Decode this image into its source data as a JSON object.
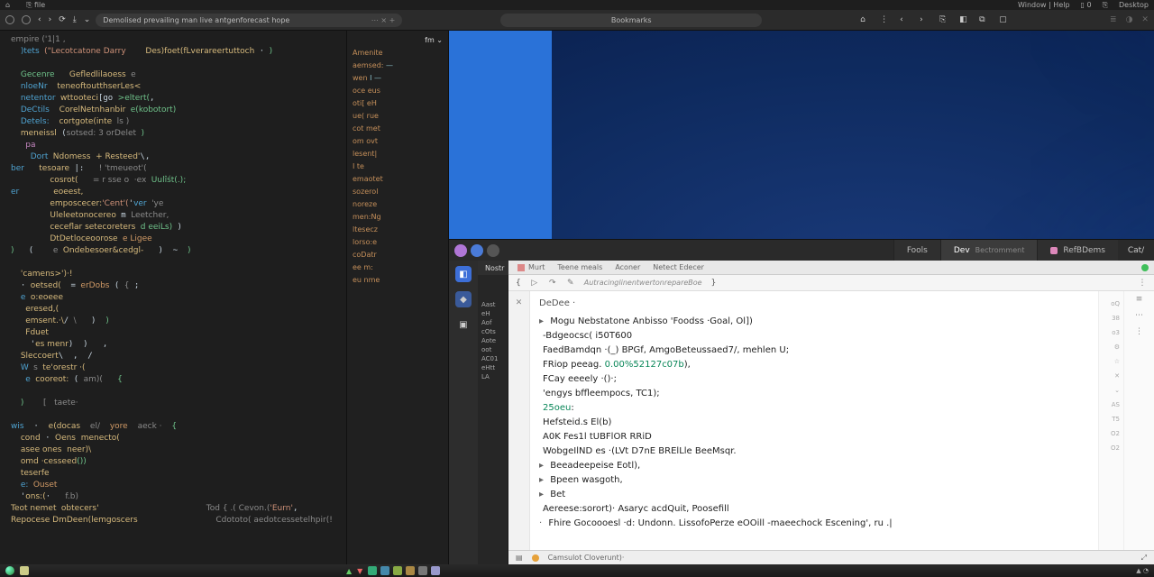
{
  "os_title": {
    "left_items": [
      "⌂",
      "⎘ file"
    ],
    "right_items": [
      "Window | Help",
      "▯ 0",
      "⎘",
      "Desktop"
    ]
  },
  "browser": {
    "url_text": "Demolised prevailing man live antgenforecast hope",
    "url_suffix": "⋯  ×   +",
    "center_text": "Bookmarks",
    "right_glyphs": [
      "⌂",
      "⋮",
      "‹",
      "›",
      "⎘",
      "◧",
      "⧉",
      "▢"
    ],
    "far_glyphs": [
      "≣",
      "◑",
      "✕"
    ]
  },
  "editor_header": "empire ('1|1 ,",
  "outline": {
    "top": "fm ⌄",
    "items": [
      {
        "k": "Amenite",
        "v": ""
      },
      {
        "k": "aemsed:",
        "v": "—"
      },
      {
        "k": "wen",
        "v": "I  —"
      },
      {
        "k": "",
        "v": ""
      },
      {
        "k": "oce eus",
        "v": ""
      },
      {
        "k": "oti[ eH",
        "v": ""
      },
      {
        "k": "ue( rue",
        "v": ""
      },
      {
        "k": "cot met",
        "v": ""
      },
      {
        "k": "om ovt",
        "v": ""
      },
      {
        "k": "lesent|",
        "v": ""
      },
      {
        "k": "    I te",
        "v": ""
      },
      {
        "k": "",
        "v": ""
      },
      {
        "k": "",
        "v": ""
      },
      {
        "k": "emaotet",
        "v": ""
      },
      {
        "k": "sozerol",
        "v": ""
      },
      {
        "k": "noreze",
        "v": ""
      },
      {
        "k": "men:Ng",
        "v": ""
      },
      {
        "k": "ltesecz",
        "v": ""
      },
      {
        "k": "lorso:e",
        "v": ""
      },
      {
        "k": "coDatr",
        "v": ""
      },
      {
        "k": "ee m:",
        "v": ""
      },
      {
        "k": "eu nme",
        "v": ""
      }
    ]
  },
  "devtools": {
    "tabs": [
      {
        "label": "Fools",
        "active": false
      },
      {
        "label": "Dev",
        "sub": "Bectromment",
        "active": true
      },
      {
        "label": "RefBDems",
        "active": false,
        "icon": "#d8b"
      }
    ],
    "gear": "Cat/",
    "activity": [
      "◧",
      "◆",
      "▣"
    ],
    "sidelist_header": "Nostr",
    "sidelist": [
      "Aast",
      "eH",
      "Aof",
      "cOts",
      "Aote",
      "oot",
      "AC01",
      "eHtt",
      "LA"
    ],
    "subtabs": [
      "Murt",
      "Teene meals",
      "Aconer",
      "Netect Edecer"
    ],
    "toolbar_path": "AutracinglinentwertonrepareBoe",
    "toolbar_brace_l": "{",
    "toolbar_brace_r": "}",
    "gutter": [
      "✕",
      "",
      "",
      "",
      "",
      "",
      "",
      "",
      "",
      "",
      "",
      "",
      ""
    ],
    "debug_label": "DeDee ·",
    "lines": [
      {
        "pre": "▸ ",
        "t": "Mogu Nebstatone Anbisso 'Foodss ·Goal, Ol])"
      },
      {
        "pre": "  ",
        "t": "-Bdgeocsc(  i50T600"
      },
      {
        "pre": "  ",
        "t": "FaedBamdqn ·(_) BPGf, AmgoBeteussaed7/, mehlen U;"
      },
      {
        "pre": "  ",
        "t": "FRiop peeag. 0.00%52127c07b),"
      },
      {
        "pre": "  ",
        "t": "FCay eeeely ·()·;"
      },
      {
        "pre": "  ",
        "t": "'engys bffleempocs, TC1);"
      },
      {
        "pre": "  ",
        "t": "25oeu:"
      },
      {
        "pre": "    ",
        "t": "Hefsteid.s El(b)"
      },
      {
        "pre": "    ",
        "t": "A0K Fes1l tUBFlOR RRiD"
      },
      {
        "pre": "    ",
        "t": "WobgeIlND es ·(LVt D7nE BRElLle BeeMsqr."
      },
      {
        "pre": "▸ ",
        "t": "Beeadeepeise Eotl),"
      },
      {
        "pre": "▸ ",
        "t": "Bpeen wasgoth,"
      },
      {
        "pre": "▸ ",
        "t": "Bet"
      },
      {
        "pre": "    ",
        "t": "Aereese:sorort)· Asaryc acdQuit, Poosefill"
      },
      {
        "pre": "  · ",
        "t": "Fhire Gocoooesl ·d: Undonn. LissofoPerze eOOill -maeechock Escening', ru .|"
      }
    ],
    "ruler": [
      "oQ",
      "38",
      "o3",
      "",
      "⚙",
      "",
      "☆",
      "",
      "✕",
      "⌄",
      "",
      "AS",
      "T5",
      "O2",
      "O2"
    ],
    "iconcol": [
      "≡",
      "⋯",
      "⋮"
    ],
    "status": {
      "led": true,
      "text": "Camsulot Cloverunt)·",
      "right": "⤢"
    }
  },
  "taskbar": {
    "icons": [
      "#3a7",
      "#48a",
      "#8a4",
      "#a84",
      "#777",
      "#99c"
    ],
    "tray": "▲ ◔"
  }
}
